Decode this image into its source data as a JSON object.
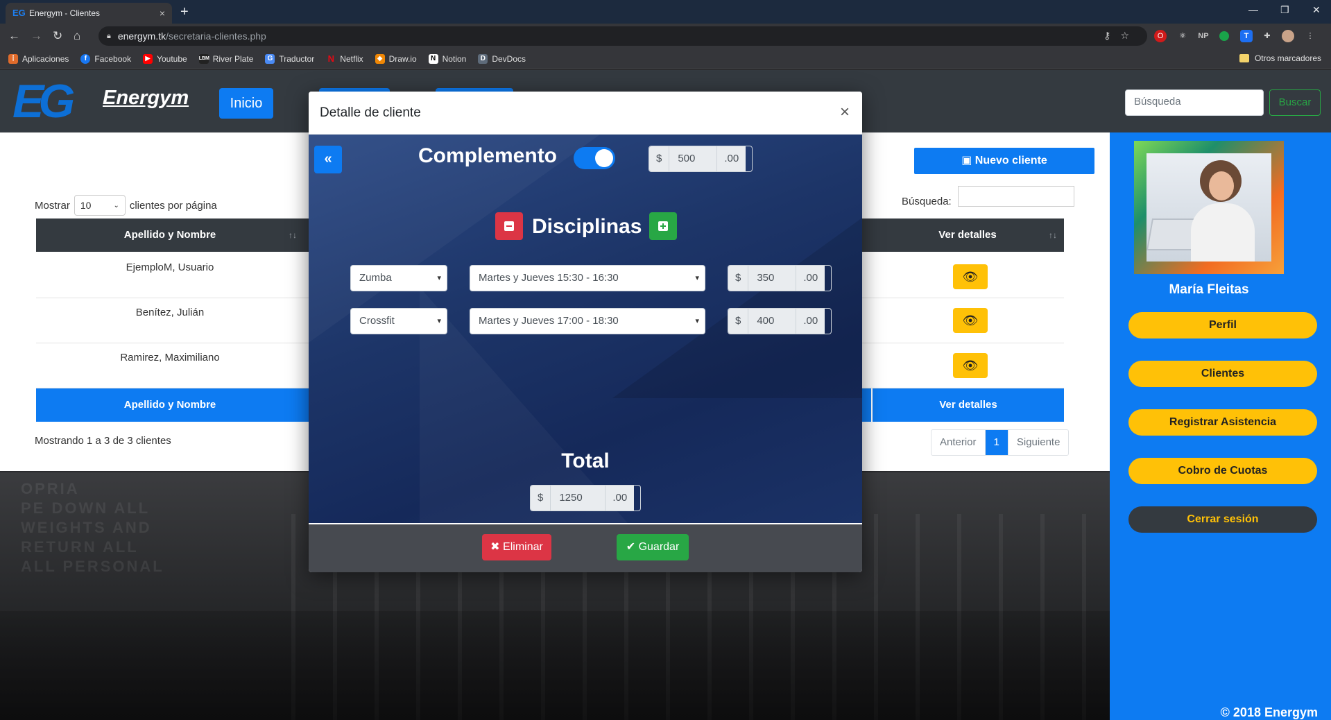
{
  "browser": {
    "tab_title": "Energym - Clientes",
    "tab_close": "×",
    "new_tab": "+",
    "url_host": "energym.tk",
    "url_path": "/secretaria-clientes.php",
    "bookmarks": [
      "Aplicaciones",
      "Facebook",
      "Youtube",
      "River Plate",
      "Traductor",
      "Netflix",
      "Draw.io",
      "Notion",
      "DevDocs"
    ],
    "other_bookmarks": "Otros marcadores"
  },
  "navbar": {
    "logo_mark": "EG",
    "logo_text": "Energym",
    "inicio": "Inicio",
    "search_placeholder": "Búsqueda",
    "search_button": "Buscar"
  },
  "clients": {
    "show_prefix": "Mostrar",
    "page_size": "10",
    "show_suffix": "clientes por página",
    "search_label": "Búsqueda:",
    "new_client": "Nuevo cliente",
    "col_name": "Apellido y Nombre",
    "col_details": "Ver detalles",
    "rows": [
      "EjemploM, Usuario",
      "Benítez, Julián",
      "Ramirez, Maximiliano"
    ],
    "footer_info": "Mostrando 1 a 3 de 3 clientes",
    "prev": "Anterior",
    "page": "1",
    "next": "Siguiente"
  },
  "sidebar": {
    "user_name": "María Fleitas",
    "buttons": [
      "Perfil",
      "Clientes",
      "Registrar Asistencia",
      "Cobro de Cuotas"
    ],
    "logout": "Cerrar sesión",
    "copyright": "© 2018 Energym"
  },
  "modal": {
    "title": "Detalle de cliente",
    "close": "×",
    "back": "«",
    "complemento": "Complemento",
    "complemento_on": true,
    "currency": "$",
    "decimals": ".00",
    "complemento_amount": "500",
    "disciplinas": "Disciplinas",
    "rows": [
      {
        "discipline": "Zumba",
        "schedule": "Martes y Jueves 15:30 - 16:30",
        "amount": "350"
      },
      {
        "discipline": "Crossfit",
        "schedule": "Martes y Jueves 17:00 - 18:30",
        "amount": "400"
      }
    ],
    "total_label": "Total",
    "total_amount": "1250",
    "delete": "Eliminar",
    "save": "Guardar"
  },
  "colors": {
    "primary": "#0d7bf2",
    "warning": "#ffc107",
    "danger": "#dc3545",
    "success": "#28a745",
    "dark": "#343a40"
  }
}
